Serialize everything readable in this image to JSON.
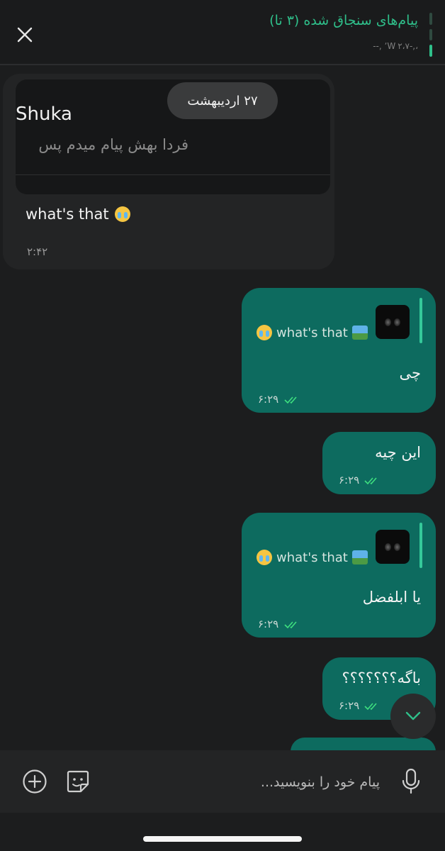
{
  "pinned": {
    "title": "پیام‌های سنجاق شده (۳ تا)",
    "preview": "،,‌-٬W۲،۷ ,--",
    "close_label": "close"
  },
  "date_pill": "۲۷ اردیبهشت",
  "messages": [
    {
      "direction": "in",
      "forwarded_name": "Shuka",
      "forwarded_text": "فردا بهش پیام میدم پس",
      "text": "what's that",
      "time": "۲:۴۲"
    },
    {
      "direction": "out",
      "reply_text": "what's that",
      "text": "چی",
      "time": "۶:۲۹"
    },
    {
      "direction": "out",
      "text": "این چیه",
      "time": "۶:۲۹"
    },
    {
      "direction": "out",
      "reply_text": "what's that",
      "text": "یا ابلفضل",
      "time": "۶:۲۹"
    },
    {
      "direction": "out",
      "text": "باگه؟؟؟؟؟؟؟",
      "time": "۶:۲۹"
    }
  ],
  "composer": {
    "placeholder": "پیام خود را بنویسید..."
  },
  "icons": {
    "close": "close-icon",
    "add": "plus-circle-icon",
    "sticker": "sticker-icon",
    "mic": "microphone-icon",
    "scroll": "chevron-down-icon",
    "read": "double-check-icon"
  },
  "colors": {
    "background": "#1c1d1e",
    "incoming": "#232425",
    "outgoing": "#0d6b5f",
    "accent": "#2fbf8a"
  }
}
